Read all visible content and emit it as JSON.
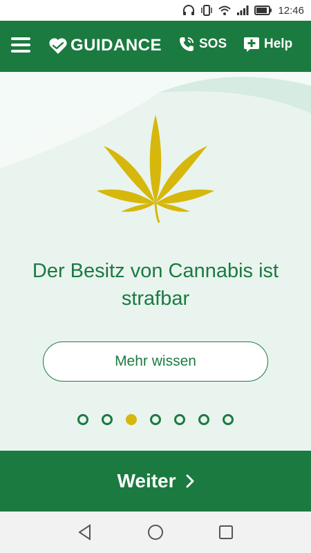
{
  "status_bar": {
    "time": "12:46",
    "icons": [
      "headphones-icon",
      "vibrate-icon",
      "wifi-icon",
      "signal-icon",
      "battery-icon"
    ]
  },
  "header": {
    "menu_icon": "hamburger-menu-icon",
    "logo_text": "GUIDANCE",
    "logo_icon": "heart-hands-icon",
    "sos_label": "SOS",
    "sos_icon": "phone-icon",
    "help_label": "Help",
    "help_icon": "chat-plus-icon"
  },
  "slide": {
    "image_icon": "cannabis-leaf-icon",
    "headline": "Der Besitz von Cannabis ist strafbar",
    "more_button": "Mehr wissen",
    "pager": {
      "total": 7,
      "active_index": 2
    }
  },
  "footer": {
    "next_label": "Weiter",
    "next_icon": "chevron-right-icon"
  },
  "system_nav": {
    "back_icon": "back-triangle-icon",
    "home_icon": "home-circle-icon",
    "recents_icon": "recents-square-icon"
  },
  "colors": {
    "brand_green": "#1b7a3f",
    "panel_bg": "#e9f4ef",
    "accent_yellow": "#d6b70c"
  }
}
